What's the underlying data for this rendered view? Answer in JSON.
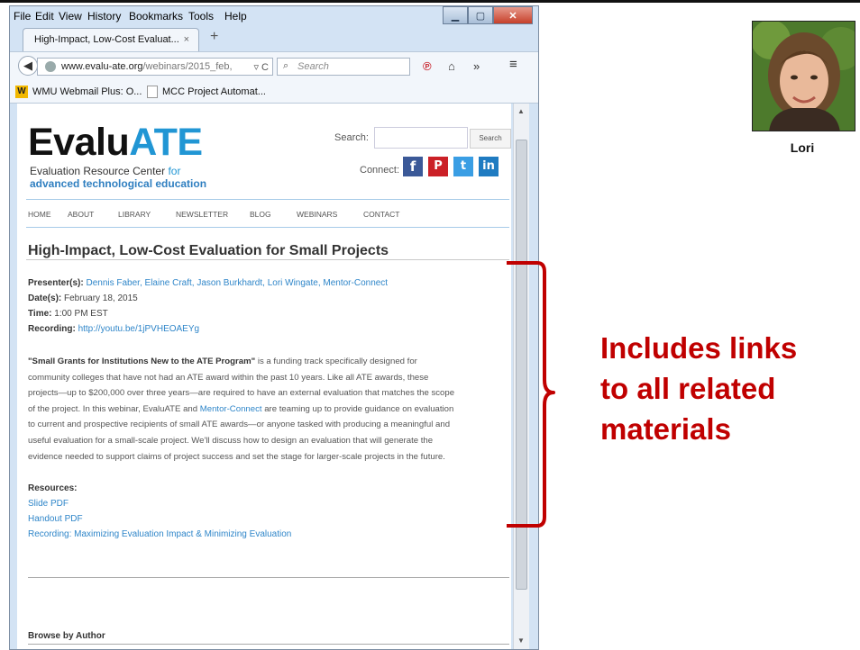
{
  "menubar": [
    "File",
    "Edit",
    "View",
    "History",
    "Bookmarks",
    "Tools",
    "Help"
  ],
  "tab": {
    "title": "High-Impact, Low-Cost Evaluat...",
    "close": "×",
    "new": "+"
  },
  "url": {
    "host": "www.evalu-ate.org",
    "path": "/webinars/2015_feb,",
    "controls": "▿ C"
  },
  "browser_search": {
    "placeholder": "Search"
  },
  "bookmarks": [
    "WMU Webmail Plus: O...",
    "MCC Project Automat..."
  ],
  "site": {
    "logo_main": "Evalu",
    "logo_accent": "ATE",
    "tagline_1": "Evaluation Resource Center",
    "tagline_for": "for",
    "tagline_2": "advanced technological education",
    "search_label": "Search:",
    "search_button": "Search",
    "connect_label": "Connect:",
    "nav": [
      "HOME",
      "ABOUT",
      "LIBRARY",
      "NEWSLETTER",
      "BLOG",
      "WEBINARS",
      "CONTACT"
    ]
  },
  "webinar": {
    "title": "High-Impact, Low-Cost Evaluation for Small Projects",
    "presenters_label": "Presenter(s):",
    "presenters": "Dennis Faber, Elaine Craft, Jason Burkhardt, Lori Wingate, Mentor-Connect",
    "date_label": "Date(s):",
    "date": "February 18, 2015",
    "time_label": "Time:",
    "time": "1:00 PM EST",
    "recording_label": "Recording:",
    "recording_url": "http://youtu.be/1jPVHEOAEYg",
    "desc_bold": "\"Small Grants for Institutions New to the ATE Program\"",
    "desc_line1_rest": " is a funding track specifically designed for",
    "desc_line2": "community colleges that have not had an ATE award within the past 10 years. Like all ATE awards, these",
    "desc_line3": "projects—up to $200,000 over three years—are required to have an external evaluation that matches the scope",
    "desc_line4_a": "of the project. In this webinar, EvaluATE and ",
    "desc_line4_link": "Mentor-Connect",
    "desc_line4_b": " are teaming up to provide guidance on evaluation",
    "desc_line5": "to current and prospective recipients of small ATE awards—or anyone tasked with producing a meaningful and",
    "desc_line6": "useful evaluation for a small-scale project.  We'll discuss how to design an evaluation that will generate the",
    "desc_line7": "evidence needed to support claims of project success and set the stage for larger-scale projects in the future.",
    "resources_label": "Resources:",
    "resources": [
      "Slide PDF",
      "Handout PDF",
      "Recording: Maximizing Evaluation Impact & Minimizing Evaluation"
    ],
    "browse_label": "Browse by Author"
  },
  "annotation": {
    "lines": [
      "Includes links",
      "to all related",
      "materials"
    ],
    "color": "#c00000"
  },
  "photo": {
    "name": "Lori"
  }
}
